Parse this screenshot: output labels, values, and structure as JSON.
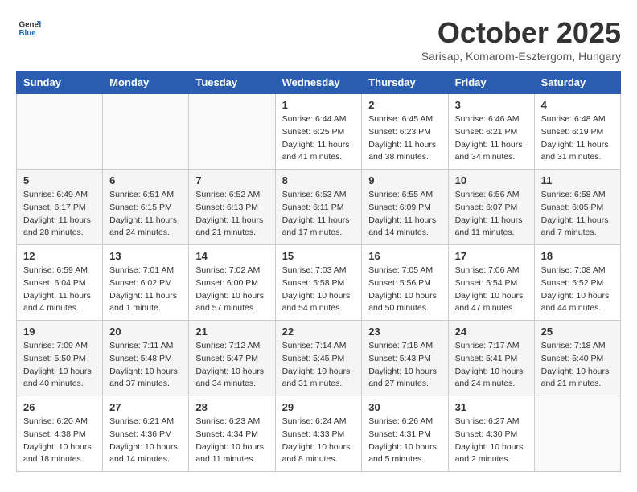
{
  "header": {
    "logo_line1": "General",
    "logo_line2": "Blue",
    "month": "October 2025",
    "location": "Sarisap, Komarom-Esztergom, Hungary"
  },
  "weekdays": [
    "Sunday",
    "Monday",
    "Tuesday",
    "Wednesday",
    "Thursday",
    "Friday",
    "Saturday"
  ],
  "weeks": [
    [
      {
        "day": "",
        "info": ""
      },
      {
        "day": "",
        "info": ""
      },
      {
        "day": "",
        "info": ""
      },
      {
        "day": "1",
        "info": "Sunrise: 6:44 AM\nSunset: 6:25 PM\nDaylight: 11 hours\nand 41 minutes."
      },
      {
        "day": "2",
        "info": "Sunrise: 6:45 AM\nSunset: 6:23 PM\nDaylight: 11 hours\nand 38 minutes."
      },
      {
        "day": "3",
        "info": "Sunrise: 6:46 AM\nSunset: 6:21 PM\nDaylight: 11 hours\nand 34 minutes."
      },
      {
        "day": "4",
        "info": "Sunrise: 6:48 AM\nSunset: 6:19 PM\nDaylight: 11 hours\nand 31 minutes."
      }
    ],
    [
      {
        "day": "5",
        "info": "Sunrise: 6:49 AM\nSunset: 6:17 PM\nDaylight: 11 hours\nand 28 minutes."
      },
      {
        "day": "6",
        "info": "Sunrise: 6:51 AM\nSunset: 6:15 PM\nDaylight: 11 hours\nand 24 minutes."
      },
      {
        "day": "7",
        "info": "Sunrise: 6:52 AM\nSunset: 6:13 PM\nDaylight: 11 hours\nand 21 minutes."
      },
      {
        "day": "8",
        "info": "Sunrise: 6:53 AM\nSunset: 6:11 PM\nDaylight: 11 hours\nand 17 minutes."
      },
      {
        "day": "9",
        "info": "Sunrise: 6:55 AM\nSunset: 6:09 PM\nDaylight: 11 hours\nand 14 minutes."
      },
      {
        "day": "10",
        "info": "Sunrise: 6:56 AM\nSunset: 6:07 PM\nDaylight: 11 hours\nand 11 minutes."
      },
      {
        "day": "11",
        "info": "Sunrise: 6:58 AM\nSunset: 6:05 PM\nDaylight: 11 hours\nand 7 minutes."
      }
    ],
    [
      {
        "day": "12",
        "info": "Sunrise: 6:59 AM\nSunset: 6:04 PM\nDaylight: 11 hours\nand 4 minutes."
      },
      {
        "day": "13",
        "info": "Sunrise: 7:01 AM\nSunset: 6:02 PM\nDaylight: 11 hours\nand 1 minute."
      },
      {
        "day": "14",
        "info": "Sunrise: 7:02 AM\nSunset: 6:00 PM\nDaylight: 10 hours\nand 57 minutes."
      },
      {
        "day": "15",
        "info": "Sunrise: 7:03 AM\nSunset: 5:58 PM\nDaylight: 10 hours\nand 54 minutes."
      },
      {
        "day": "16",
        "info": "Sunrise: 7:05 AM\nSunset: 5:56 PM\nDaylight: 10 hours\nand 50 minutes."
      },
      {
        "day": "17",
        "info": "Sunrise: 7:06 AM\nSunset: 5:54 PM\nDaylight: 10 hours\nand 47 minutes."
      },
      {
        "day": "18",
        "info": "Sunrise: 7:08 AM\nSunset: 5:52 PM\nDaylight: 10 hours\nand 44 minutes."
      }
    ],
    [
      {
        "day": "19",
        "info": "Sunrise: 7:09 AM\nSunset: 5:50 PM\nDaylight: 10 hours\nand 40 minutes."
      },
      {
        "day": "20",
        "info": "Sunrise: 7:11 AM\nSunset: 5:48 PM\nDaylight: 10 hours\nand 37 minutes."
      },
      {
        "day": "21",
        "info": "Sunrise: 7:12 AM\nSunset: 5:47 PM\nDaylight: 10 hours\nand 34 minutes."
      },
      {
        "day": "22",
        "info": "Sunrise: 7:14 AM\nSunset: 5:45 PM\nDaylight: 10 hours\nand 31 minutes."
      },
      {
        "day": "23",
        "info": "Sunrise: 7:15 AM\nSunset: 5:43 PM\nDaylight: 10 hours\nand 27 minutes."
      },
      {
        "day": "24",
        "info": "Sunrise: 7:17 AM\nSunset: 5:41 PM\nDaylight: 10 hours\nand 24 minutes."
      },
      {
        "day": "25",
        "info": "Sunrise: 7:18 AM\nSunset: 5:40 PM\nDaylight: 10 hours\nand 21 minutes."
      }
    ],
    [
      {
        "day": "26",
        "info": "Sunrise: 6:20 AM\nSunset: 4:38 PM\nDaylight: 10 hours\nand 18 minutes."
      },
      {
        "day": "27",
        "info": "Sunrise: 6:21 AM\nSunset: 4:36 PM\nDaylight: 10 hours\nand 14 minutes."
      },
      {
        "day": "28",
        "info": "Sunrise: 6:23 AM\nSunset: 4:34 PM\nDaylight: 10 hours\nand 11 minutes."
      },
      {
        "day": "29",
        "info": "Sunrise: 6:24 AM\nSunset: 4:33 PM\nDaylight: 10 hours\nand 8 minutes."
      },
      {
        "day": "30",
        "info": "Sunrise: 6:26 AM\nSunset: 4:31 PM\nDaylight: 10 hours\nand 5 minutes."
      },
      {
        "day": "31",
        "info": "Sunrise: 6:27 AM\nSunset: 4:30 PM\nDaylight: 10 hours\nand 2 minutes."
      },
      {
        "day": "",
        "info": ""
      }
    ]
  ]
}
